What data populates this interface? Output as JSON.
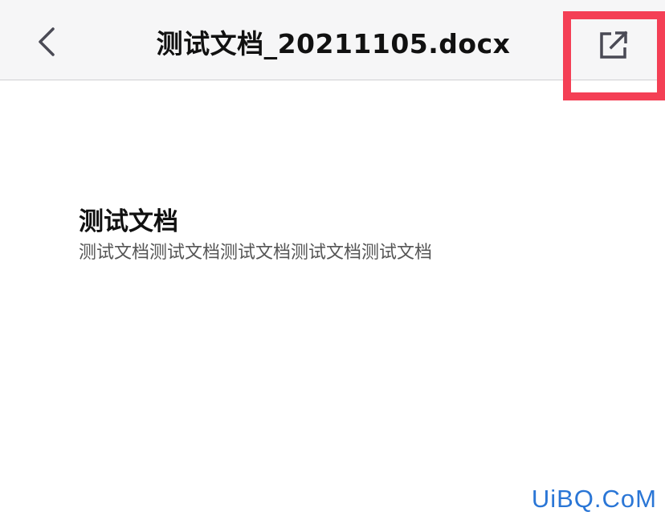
{
  "header": {
    "title": "测试文档_20211105.docx",
    "back_icon": "chevron-left-icon",
    "share_icon": "open-external-icon",
    "highlight_color": "#f43f55"
  },
  "document": {
    "heading": "测试文档",
    "paragraph": "测试文档测试文档测试文档测试文档测试文档"
  },
  "watermark": {
    "text": "UiBQ.CoM",
    "color": "#2a76d6"
  }
}
